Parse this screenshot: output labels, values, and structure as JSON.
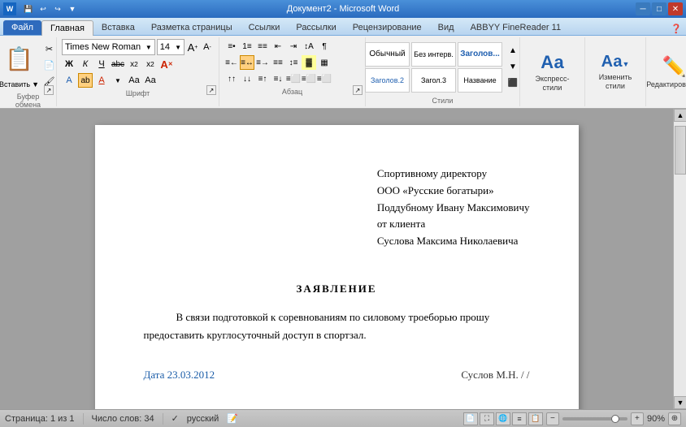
{
  "titlebar": {
    "title": "Документ2 - Microsoft Word",
    "min_label": "─",
    "max_label": "□",
    "close_label": "✕",
    "app_icon": "W"
  },
  "quickaccess": {
    "save": "💾",
    "undo": "↩",
    "redo": "↪",
    "dropdown": "▼"
  },
  "ribbon": {
    "tabs": [
      {
        "label": "Файл",
        "active": false,
        "file": true
      },
      {
        "label": "Главная",
        "active": true
      },
      {
        "label": "Вставка",
        "active": false
      },
      {
        "label": "Разметка страницы",
        "active": false
      },
      {
        "label": "Ссылки",
        "active": false
      },
      {
        "label": "Рассылки",
        "active": false
      },
      {
        "label": "Рецензирование",
        "active": false
      },
      {
        "label": "Вид",
        "active": false
      },
      {
        "label": "ABBYY FineReader 11",
        "active": false
      }
    ],
    "groups": {
      "clipboard": {
        "label": "Буфер обмена",
        "paste": "Вставить"
      },
      "font": {
        "label": "Шрифт",
        "name": "Times New Roman",
        "size": "14",
        "bold": "Ж",
        "italic": "К",
        "underline": "Ч",
        "strikethrough": "abc",
        "subscript": "x₂",
        "superscript": "x²",
        "clear": "A"
      },
      "paragraph": {
        "label": "Абзац"
      },
      "styles": {
        "label": "Стили",
        "express_label": "Экспресс-стили",
        "change_label": "Изменить стили"
      },
      "editing": {
        "label": "Редактирование"
      }
    }
  },
  "document": {
    "addressee_line1": "Спортивному директору",
    "addressee_line2": "ООО «Русские богатыри»",
    "addressee_line3": "Поддубному Ивану Максимовичу",
    "addressee_line4": "от клиента",
    "addressee_line5": "Суслова Максима Николаевича",
    "title": "ЗАЯВЛЕНИЕ",
    "body": "В связи подготовкой к соревнованиям по силовому троеборью прошу предоставить круглосуточный доступ в спортзал.",
    "date_label": "Дата 23.03.2012",
    "sign_label": "Суслов М.Н. /                /"
  },
  "statusbar": {
    "page": "Страница: 1 из 1",
    "words": "Число слов: 34",
    "language": "русский",
    "zoom": "90%",
    "zoom_value": 90
  }
}
